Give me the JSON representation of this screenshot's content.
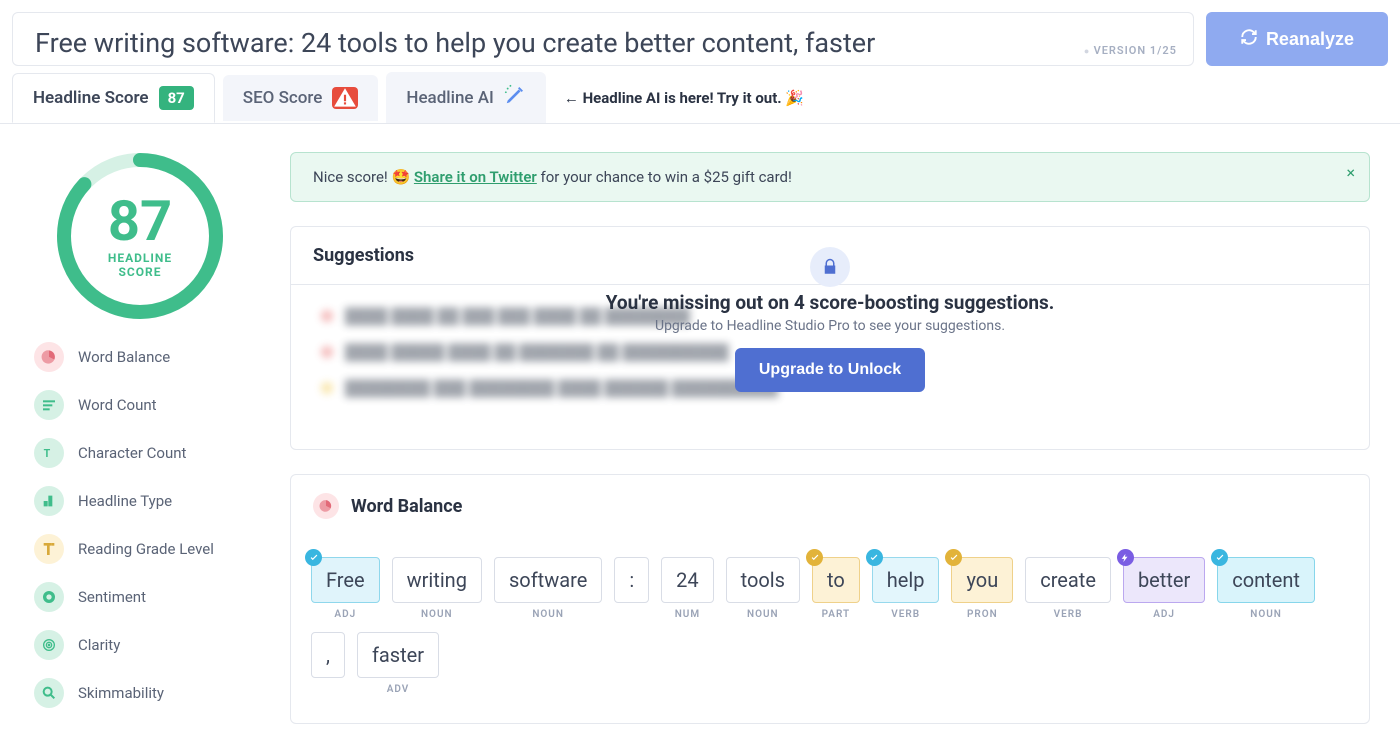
{
  "header": {
    "headline": "Free writing software: 24 tools to help you create better content, faster",
    "version": "VERSION 1/25",
    "reanalyze": "Reanalyze"
  },
  "tabs": {
    "headline_score": {
      "label": "Headline Score",
      "score": "87"
    },
    "seo_score": {
      "label": "SEO Score"
    },
    "headline_ai": {
      "label": "Headline AI"
    },
    "callout": "← Headline AI is here! Try it out. 🎉"
  },
  "score_circle": {
    "value": "87",
    "label": "HEADLINE\nSCORE"
  },
  "sidebar": {
    "items": [
      {
        "label": "Word Balance"
      },
      {
        "label": "Word Count"
      },
      {
        "label": "Character Count"
      },
      {
        "label": "Headline Type"
      },
      {
        "label": "Reading Grade Level"
      },
      {
        "label": "Sentiment"
      },
      {
        "label": "Clarity"
      },
      {
        "label": "Skimmability"
      }
    ]
  },
  "banner": {
    "prefix": "Nice score! 🤩 ",
    "link": "Share it on Twitter",
    "suffix": " for your chance to win a $25 gift card!"
  },
  "suggestions": {
    "title": "Suggestions",
    "overlay_heading": "You're missing out on 4 score-boosting suggestions.",
    "overlay_sub": "Upgrade to Headline Studio Pro to see your suggestions.",
    "upgrade_btn": "Upgrade to Unlock"
  },
  "word_balance": {
    "title": "Word Balance",
    "words": [
      {
        "text": "Free",
        "pos": "ADJ",
        "color": "c-blue",
        "badge": "b-blue",
        "badge_shape": "check"
      },
      {
        "text": "writing",
        "pos": "NOUN"
      },
      {
        "text": "software",
        "pos": "NOUN"
      },
      {
        "text": ":",
        "pos": ""
      },
      {
        "text": "24",
        "pos": "NUM"
      },
      {
        "text": "tools",
        "pos": "NOUN"
      },
      {
        "text": "to",
        "pos": "PART",
        "color": "c-yellow",
        "badge": "b-yellow",
        "badge_shape": "check"
      },
      {
        "text": "help",
        "pos": "VERB",
        "color": "c-lblue",
        "badge": "b-blue",
        "badge_shape": "check"
      },
      {
        "text": "you",
        "pos": "PRON",
        "color": "c-yellow",
        "badge": "b-yellow",
        "badge_shape": "check"
      },
      {
        "text": "create",
        "pos": "VERB"
      },
      {
        "text": "better",
        "pos": "ADJ",
        "color": "c-purple",
        "badge": "b-purple",
        "badge_shape": "bolt"
      },
      {
        "text": "content",
        "pos": "NOUN",
        "color": "c-cyan",
        "badge": "b-blue",
        "badge_shape": "check"
      },
      {
        "text": ",",
        "pos": ""
      },
      {
        "text": "faster",
        "pos": "ADV"
      }
    ]
  }
}
